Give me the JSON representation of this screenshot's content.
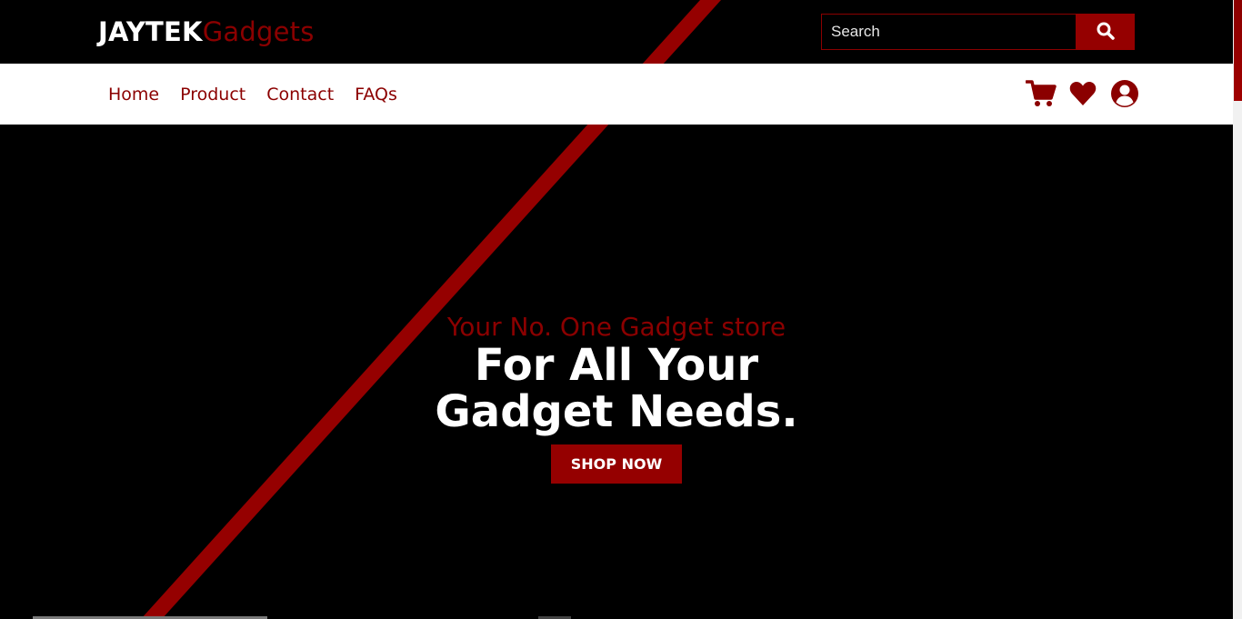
{
  "brand": {
    "part1": "JAYTEK",
    "part2": "Gadgets"
  },
  "search": {
    "placeholder": "Search",
    "button_icon": "search-icon"
  },
  "nav": {
    "links": [
      "Home",
      "Product",
      "Contact",
      "FAQs"
    ],
    "icons": [
      "cart-icon",
      "heart-icon",
      "user-icon"
    ]
  },
  "hero": {
    "tagline": "Your No. One Gadget store",
    "headline_line1": "For All Your",
    "headline_line2": "Gadget Needs.",
    "cta": "SHOP NOW"
  },
  "colors": {
    "accent": "#8b0000",
    "button": "#950000",
    "background": "#000000",
    "nav_background": "#ffffff"
  }
}
